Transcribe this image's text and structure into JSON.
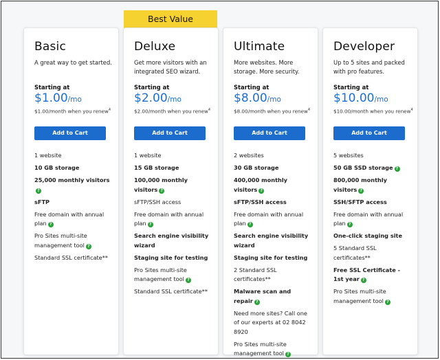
{
  "badge": "Best Value",
  "cards": [
    {
      "name": "Basic",
      "desc": "A great way to get started.",
      "starting": "Starting at",
      "price": "$1.00",
      "per": "/mo",
      "renew": "$1.00/month when you renew",
      "renew_sup": "4",
      "cta": "Add to Cart",
      "features": [
        {
          "text": "1 website"
        },
        {
          "text": "10 GB storage"
        },
        {
          "text": "25,000 monthly visitors",
          "help": true
        },
        {
          "text": "sFTP"
        },
        {
          "text": "Free domain with annual plan",
          "help": true
        },
        {
          "text": "Pro Sites multi-site management tool",
          "help": true
        },
        {
          "text": "Standard SSL certificate**"
        }
      ]
    },
    {
      "name": "Deluxe",
      "desc": "Get more visitors with an integrated SEO wizard.",
      "starting": "Starting at",
      "price": "$2.00",
      "per": "/mo",
      "renew": "$2.00/month when you renew",
      "renew_sup": "4",
      "cta": "Add to Cart",
      "features": [
        {
          "text": "1 website"
        },
        {
          "text": "15 GB storage"
        },
        {
          "text": "100,000 monthly visitors",
          "help": true
        },
        {
          "text": "sFTP/SSH access"
        },
        {
          "text": "Free domain with annual plan",
          "help": true
        },
        {
          "text": "Search engine visibility wizard"
        },
        {
          "text": "Staging site for testing"
        },
        {
          "text": "Pro Sites multi-site management tool",
          "help": true
        },
        {
          "text": "Standard SSL certificate**"
        }
      ]
    },
    {
      "name": "Ultimate",
      "desc": "More websites. More storage. More security.",
      "starting": "Starting at",
      "price": "$8.00",
      "per": "/mo",
      "renew": "$8.00/month when you renew",
      "renew_sup": "4",
      "cta": "Add to Cart",
      "features": [
        {
          "text": "2 websites"
        },
        {
          "text": "30 GB storage"
        },
        {
          "text": "400,000 monthly visitors",
          "help": true
        },
        {
          "text": "sFTP/SSH access"
        },
        {
          "text": "Free domain with annual plan",
          "help": true
        },
        {
          "text": "Search engine visibility wizard"
        },
        {
          "text": "Staging site for testing"
        },
        {
          "text": "2 Standard SSL certificates**"
        },
        {
          "text": "Malware scan and repair",
          "help": true
        },
        {
          "text": "Need more sites? Call one of our experts at 02 8042 8920"
        },
        {
          "text": "Pro Sites multi-site management tool",
          "help": true
        }
      ]
    },
    {
      "name": "Developer",
      "desc": "Up to 5 sites and packed with pro features.",
      "starting": "Starting at",
      "price": "$10.00",
      "per": "/mo",
      "renew": "$10.00/month when you renew",
      "renew_sup": "4",
      "cta": "Add to Cart",
      "features": [
        {
          "text": "5 websites"
        },
        {
          "text": "50 GB SSD storage",
          "help": true
        },
        {
          "text": "800,000 monthly visitors",
          "help": true
        },
        {
          "text": "SSH/SFTP access"
        },
        {
          "text": "Free domain with annual plan",
          "help": true
        },
        {
          "text": "One-click staging site"
        },
        {
          "text": "5 Standard SSL certificates**"
        },
        {
          "text": "Free SSL Certificate - 1st year",
          "help": true
        },
        {
          "text": "Pro Sites multi-site management tool",
          "help": true
        }
      ]
    }
  ]
}
